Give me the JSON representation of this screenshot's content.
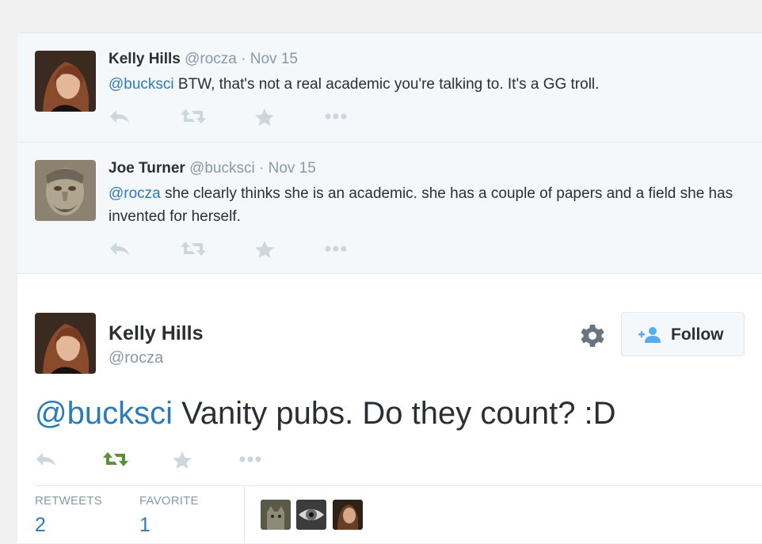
{
  "replies": [
    {
      "name": "Kelly Hills",
      "handle": "@rocza",
      "separator": "·",
      "date": "Nov 15",
      "mention": "@bucksci",
      "text": " BTW, that's not a real academic you're talking to. It's a GG troll."
    },
    {
      "name": "Joe Turner",
      "handle": "@bucksci",
      "separator": "·",
      "date": "Nov 15",
      "mention": "@rocza",
      "text": " she clearly thinks she is an academic.  she has a couple of papers and a field she has invented for herself."
    }
  ],
  "main_tweet": {
    "name": "Kelly Hills",
    "handle": "@rocza",
    "follow_label": "Follow",
    "mention": "@bucksci",
    "text": " Vanity pubs. Do they count? :D"
  },
  "stats": {
    "retweets_label": "RETWEETS",
    "retweets_count": "2",
    "favorites_label": "FAVORITE",
    "favorites_count": "1"
  },
  "icons": {
    "reply": "reply-icon",
    "retweet": "retweet-icon",
    "favorite": "star-icon",
    "more": "more-icon",
    "settings": "gear-icon",
    "follow": "add-user-icon"
  },
  "colors": {
    "link": "#2b7bb9",
    "retweeted": "#5c913b",
    "action_gray": "#ccd6dd",
    "follow_icon": "#55acee"
  }
}
